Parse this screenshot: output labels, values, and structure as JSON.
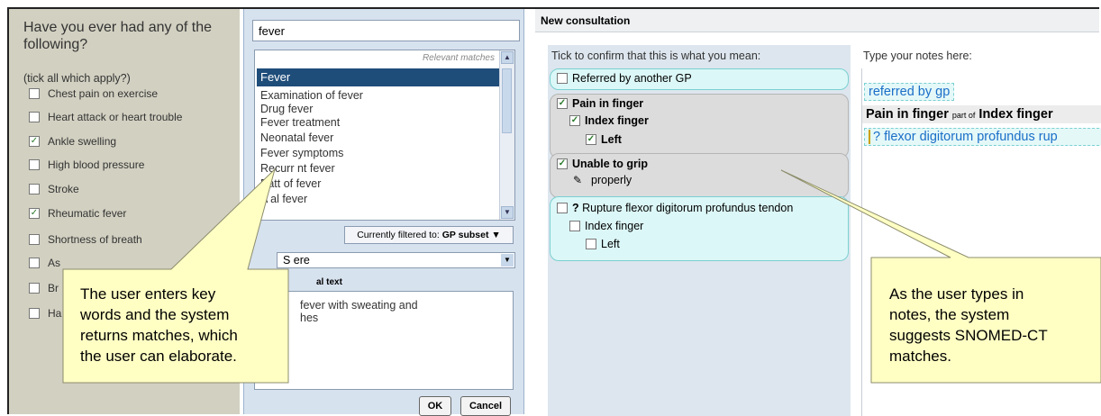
{
  "questionnaire": {
    "title": "Have you ever had any of the following?",
    "subtitle": "(tick all which apply?)",
    "items": [
      {
        "label": "Chest pain on exercise",
        "checked": false
      },
      {
        "label": "Heart attack or heart trouble",
        "checked": false
      },
      {
        "label": "Ankle swelling",
        "checked": true
      },
      {
        "label": "High blood pressure",
        "checked": false
      },
      {
        "label": "Stroke",
        "checked": false
      },
      {
        "label": "Rheumatic fever",
        "checked": true
      },
      {
        "label": "Shortness of breath",
        "checked": false
      },
      {
        "label": "As",
        "checked": false
      },
      {
        "label": "Br",
        "checked": false
      },
      {
        "label": "Ha",
        "checked": false
      }
    ]
  },
  "search_dialog": {
    "search_value": "fever",
    "relevant_hint": "Relevant matches",
    "selected": "Fever",
    "results": [
      "Examination of fever",
      "Drug fever",
      "Fever treatment",
      "Neonatal fever",
      "Fever symptoms",
      "Recurr  nt fever",
      "Patt  of fever",
      "A  al fever"
    ],
    "filter_prefix": "Currently filtered to:",
    "filter_value": "GP subset",
    "severity_value": "S  ere",
    "additional_label": "al text",
    "additional_text_1": "fever with sweating and",
    "additional_text_2": "hes",
    "ok_label": "OK",
    "cancel_label": "Cancel"
  },
  "consultation": {
    "title": "New consultation",
    "instruction": "Tick to confirm that this is what you mean:",
    "notes_label": "Type your notes here:",
    "cards": {
      "referred": "Referred by another GP",
      "pain": "Pain in finger",
      "index": "Index finger",
      "left": "Left",
      "unable": "Unable to grip",
      "properly": "properly",
      "rupture_q": "?",
      "rupture": "Rupture flexor digitorum profundus tendon",
      "index2": "Index finger",
      "left2": "Left"
    },
    "notes": {
      "line1": "referred by gp",
      "line2_main": "Pain in finger",
      "line2_part": "part of",
      "line2_target": "Index finger",
      "line3": "? flexor digitorum profundus rup"
    }
  },
  "callouts": {
    "left_1": "The user enters key",
    "left_2": "words and the system",
    "left_3": "returns matches, which",
    "left_4": "the user can elaborate.",
    "right_1": "As the user types in",
    "right_2": "notes, the system",
    "right_3": "suggests SNOMED-CT",
    "right_4": "matches."
  },
  "colors": {
    "selection": "#1f4d7a",
    "callout_fill": "#ffffc4",
    "card_cyan": "#dcf7f7",
    "card_grey": "#dcdcdc",
    "check": "#2a7a2a"
  }
}
